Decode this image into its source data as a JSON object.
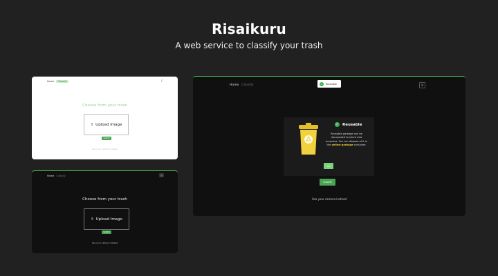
{
  "header": {
    "title": "Risaikuru",
    "subtitle": "A web service to classify your trash"
  },
  "shot_light": {
    "nav_home": "Home",
    "nav_classify": "Classify",
    "theme_icon": "moon-icon",
    "choose_label": "Choose from your trash",
    "upload_label": "Upload Image",
    "submit_label": "Submit",
    "camera_link": "Use your camera instead"
  },
  "shot_dark_small": {
    "nav_home": "Home",
    "nav_classify": "Classify",
    "theme_icon": "sun-icon",
    "choose_label": "Choose from your trash",
    "upload_label": "Upload Image",
    "submit_label": "Submit",
    "camera_link": "Use your camera instead"
  },
  "shot_dark_large": {
    "nav_home": "Home",
    "nav_classify": "Classify",
    "toast_label": "Reusable",
    "theme_icon": "sun-icon",
    "submit_label": "Submit",
    "camera_link": "Use your camera instead",
    "modal": {
      "title": "Reusable",
      "desc_before": "Reusable garbage can be repurposed to serve new purposes. You can dispose of it in the ",
      "desc_highlight": "yellow garbage",
      "desc_after": " container.",
      "ok_label": "OK"
    }
  },
  "colors": {
    "background": "#222121",
    "accent_green": "#4fcb5c",
    "bin_yellow": "#f2d23c"
  }
}
